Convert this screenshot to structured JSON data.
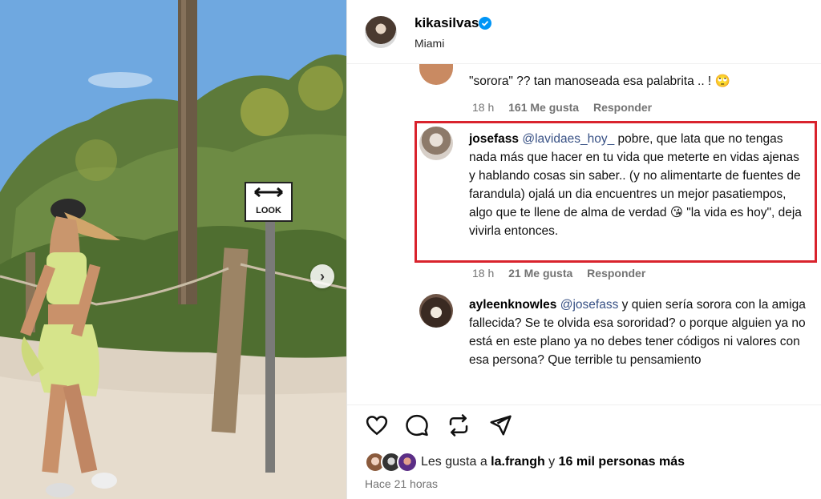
{
  "post": {
    "username": "kikasilvas",
    "location": "Miami",
    "sign_text": "LOOK",
    "posted_ago": "Hace 21 horas"
  },
  "comments": [
    {
      "username": "",
      "text": "\"sorora\" ?? tan manoseada esa palabrita .. ! 🙄",
      "time": "18 h",
      "likes": "161 Me gusta",
      "reply": "Responder"
    },
    {
      "username": "josefass",
      "mention": "@lavidaes_hoy_",
      "text": " pobre, que lata que no tengas nada más que hacer en tu vida que meterte en vidas ajenas y hablando cosas sin saber.. (y no alimentarte de fuentes de farandula) ojalá un dia encuentres un mejor pasatiempos, algo que te llene de alma de verdad 😘 \"la vida es hoy\", deja vivirla entonces.",
      "time": "18 h",
      "likes": "21 Me gusta",
      "reply": "Responder"
    },
    {
      "username": "ayleenknowles",
      "mention": "@josefass",
      "text": " y quien sería sorora con la amiga fallecida? Se te olvida esa sororidad? o porque alguien ya no está en este plano ya no debes tener códigos ni valores con esa persona? Que terrible tu pensamiento"
    }
  ],
  "likes_summary": {
    "prefix": "Les gusta a ",
    "user": "la.frangh",
    "connector": " y ",
    "others": "16 mil personas más"
  },
  "icons": {
    "like": "heart-icon",
    "comment": "comment-icon",
    "repost": "repost-icon",
    "share": "send-icon",
    "next": "chevron-right-icon",
    "verified": "verified-badge-icon"
  },
  "colors": {
    "highlight_border": "#d9232d",
    "mention": "#385185",
    "verified": "#0095f6",
    "meta": "#737373"
  }
}
